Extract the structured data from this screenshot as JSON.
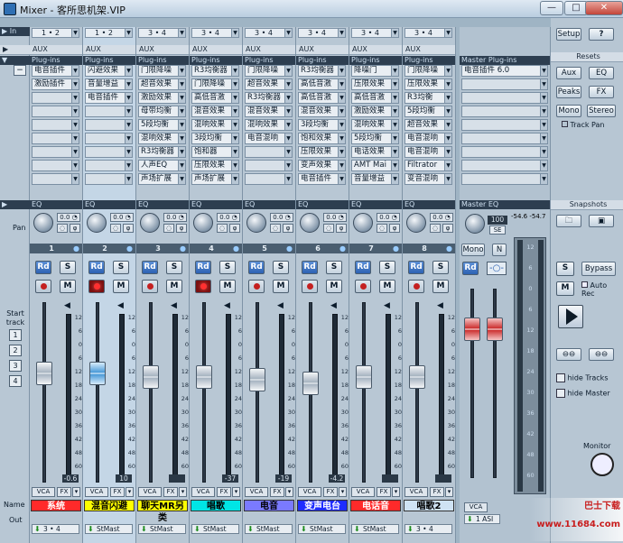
{
  "window": {
    "title": "Mixer - 客所思机架.VIP",
    "minimize": "—",
    "maximize": "□",
    "close": "✕"
  },
  "left": {
    "in_label": "In",
    "aux_label": "AUX",
    "plugins_label": "Plug-ins",
    "eq_label": "EQ",
    "pan_label": "Pan",
    "start_track_label": "Start track",
    "track_buttons": [
      "1",
      "2",
      "3",
      "4"
    ],
    "name_label": "Name",
    "out_label": "Out"
  },
  "channels": [
    {
      "in": "1 • 2",
      "aux": "AUX",
      "plugins_label": "Plug-ins",
      "eq": "EQ",
      "number": "1",
      "plugins": [
        "电音插件",
        "激励插件",
        "",
        "",
        "",
        "",
        "",
        "",
        ""
      ],
      "level": "-0.6",
      "name": "系统",
      "name_color": "#ff2a2a",
      "name_text_color": "#ffffff",
      "out": "3 • 4",
      "rec_on": false,
      "fader_color": "gray",
      "fader_level_pct": 62
    },
    {
      "in": "1 • 2",
      "aux": "AUX",
      "plugins_label": "Plug-ins",
      "eq": "EQ",
      "number": "2",
      "plugins": [
        "闪避效果",
        "音量增益",
        "电音插件",
        "",
        "",
        "",
        "",
        "",
        ""
      ],
      "level": "10",
      "name": "混音闪避",
      "name_color": "#ffff00",
      "name_text_color": "#000000",
      "out": "StMast",
      "rec_on": true,
      "fader_color": "blue",
      "fader_level_pct": 62
    },
    {
      "in": "3 • 4",
      "aux": "AUX",
      "plugins_label": "Plug-ins",
      "eq": "EQ",
      "number": "3",
      "plugins": [
        "门限降噪",
        "超音效果",
        "激励效果",
        "母带均衡",
        "5段均衡",
        "混响效果",
        "R3均衡器",
        "人声EQ",
        "声场扩展"
      ],
      "level": "",
      "name": "聊天MR另类",
      "name_color": "#ffff00",
      "name_text_color": "#000000",
      "out": "StMast",
      "rec_on": false,
      "fader_color": "gray",
      "fader_level_pct": 60
    },
    {
      "in": "3 • 4",
      "aux": "AUX",
      "plugins_label": "Plug-ins",
      "eq": "EQ",
      "number": "4",
      "plugins": [
        "R3均衡器",
        "门限降噪",
        "高低音激",
        "混音效果",
        "混响效果",
        "3段均衡",
        "饱和器",
        "压限效果",
        "声场扩展"
      ],
      "level": "-37",
      "name": "唱歌",
      "name_color": "#00e5e5",
      "name_text_color": "#000000",
      "out": "StMast",
      "rec_on": true,
      "fader_color": "gray",
      "fader_level_pct": 60
    },
    {
      "in": "3 • 4",
      "aux": "AUX",
      "plugins_label": "Plug-ins",
      "eq": "EQ",
      "number": "5",
      "plugins": [
        "门限降噪",
        "超音效果",
        "R3均衡器",
        "混音效果",
        "混响效果",
        "电音混响",
        "",
        "",
        ""
      ],
      "level": "-19",
      "name": "电音",
      "name_color": "#7a7aff",
      "name_text_color": "#000000",
      "out": "StMast",
      "rec_on": false,
      "fader_color": "gray",
      "fader_level_pct": 58
    },
    {
      "in": "3 • 4",
      "aux": "AUX",
      "plugins_label": "Plug-ins",
      "eq": "EQ",
      "number": "6",
      "plugins": [
        "R3均衡器",
        "高低音激",
        "高低音激",
        "混音效果",
        "3段均衡",
        "饱和效果",
        "压限效果",
        "变声效果",
        "电音插件"
      ],
      "level": "-4.2",
      "name": "变声电台",
      "name_color": "#1e2cff",
      "name_text_color": "#ffffff",
      "out": "StMast",
      "rec_on": false,
      "fader_color": "gray",
      "fader_level_pct": 56
    },
    {
      "in": "3 • 4",
      "aux": "AUX",
      "plugins_label": "Plug-ins",
      "eq": "EQ",
      "number": "7",
      "plugins": [
        "降噪门",
        "压限效果",
        "高低音激",
        "激励效果",
        "混响效果",
        "5段均衡",
        "电话效果",
        "AMT Mai",
        "音量增益"
      ],
      "level": "",
      "name": "电话音",
      "name_color": "#ff2a2a",
      "name_text_color": "#ffffff",
      "out": "StMast",
      "rec_on": false,
      "fader_color": "gray",
      "fader_level_pct": 60
    },
    {
      "in": "3 • 4",
      "aux": "AUX",
      "plugins_label": "Plug-ins",
      "eq": "EQ",
      "number": "8",
      "plugins": [
        "门限降噪",
        "压限效果",
        "R3均衡",
        "5段均衡",
        "超音效果",
        "电音混响",
        "电音混响",
        "Filtrator",
        "变音混响"
      ],
      "level": "",
      "name": "唱歌2",
      "name_color": "#cfe3f4",
      "name_text_color": "#000000",
      "out": "3 • 4",
      "rec_on": false,
      "fader_color": "gray",
      "fader_level_pct": 60
    }
  ],
  "master": {
    "plugins_label": "Master Plug-ins",
    "plugins": [
      "电音插件 6.0",
      "",
      "",
      "",
      "",
      "",
      "",
      "",
      ""
    ],
    "eq_label": "Master EQ",
    "meter_left": "-54.6",
    "meter_right": "-54.7",
    "sec_value": "100",
    "sec_label": "SE",
    "mono_label": "Mono",
    "n_label": "N",
    "out": "1 ASI",
    "scale": [
      "12",
      "6",
      "0",
      "6",
      "12",
      "18",
      "24",
      "30",
      "36",
      "42",
      "48",
      "60"
    ]
  },
  "right": {
    "setup": "Setup",
    "help": "?",
    "resets": "Resets",
    "aux": "Aux",
    "eq": "EQ",
    "peaks": "Peaks",
    "fx": "FX",
    "mono": "Mono",
    "stereo": "Stereo",
    "track_pan": "Track Pan",
    "snapshots": "Snapshots",
    "s": "S",
    "m": "M",
    "bypass": "Bypass",
    "auto_rec": "Auto Rec",
    "hide_tracks": "hide Tracks",
    "hide_master": "hide Master",
    "monitor": "Monitor"
  },
  "buttons": {
    "rd": "Rd",
    "s": "S",
    "m": "M",
    "vca": "VCA",
    "fx": "FX"
  },
  "fader_scale": [
    "12",
    "6",
    "0",
    "6",
    "12",
    "18",
    "24",
    "30",
    "36",
    "42",
    "48",
    "60"
  ],
  "watermark": "巴士下载 www.11684.com"
}
